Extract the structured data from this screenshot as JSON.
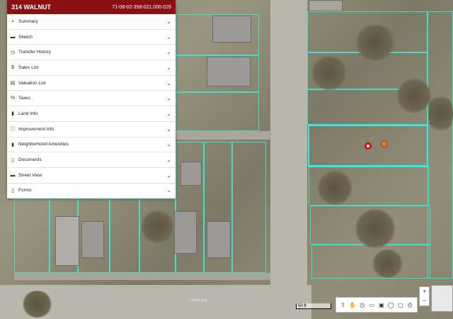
{
  "property": {
    "title": "314 WALNUT",
    "parcel_id": "71-08-02-358-021.000-026"
  },
  "menu": [
    {
      "label": "Summary",
      "icon": "summary-icon",
      "glyph": "▪"
    },
    {
      "label": "Sketch",
      "icon": "sketch-icon",
      "glyph": "▬"
    },
    {
      "label": "Transfer History",
      "icon": "history-icon",
      "glyph": "◷"
    },
    {
      "label": "Sales List",
      "icon": "sales-icon",
      "glyph": "$"
    },
    {
      "label": "Valuation List",
      "icon": "valuation-icon",
      "glyph": "▤"
    },
    {
      "label": "Taxes",
      "icon": "taxes-icon",
      "glyph": "%"
    },
    {
      "label": "Land Info",
      "icon": "map-icon",
      "glyph": "▮"
    },
    {
      "label": "Improvement Info",
      "icon": "info-icon",
      "glyph": "ⓘ"
    },
    {
      "label": "Neighborhood Amenities",
      "icon": "amenities-icon",
      "glyph": "▮"
    },
    {
      "label": "Documents",
      "icon": "document-icon",
      "glyph": "▯"
    },
    {
      "label": "Street View",
      "icon": "street-view-icon",
      "glyph": "▬"
    },
    {
      "label": "Forms",
      "icon": "forms-icon",
      "glyph": "▯"
    }
  ],
  "chevron": "⌄",
  "map": {
    "scale_label": "50 ft",
    "street_label": "Linden Ave"
  },
  "toolbar": {
    "north": "⇧",
    "tools": [
      "✋",
      "◷",
      "▭",
      "▣",
      "◯",
      "▢",
      "⎙"
    ]
  },
  "zoom": {
    "in": "+",
    "out": "−"
  },
  "colors": {
    "header": "#8b1014",
    "parcel_outline": "#3fe0c6",
    "selected_outline": "#22f5f0",
    "marker_red": "#c8141c",
    "marker_orange": "#e07a2a"
  }
}
